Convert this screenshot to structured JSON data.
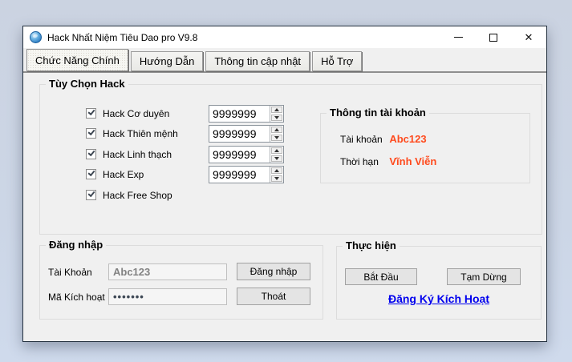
{
  "window": {
    "title": "Hack Nhất Niệm Tiêu Dao pro V9.8",
    "controls": {
      "close_glyph": "✕"
    }
  },
  "tabs": [
    {
      "label": "Chức Năng Chính",
      "active": true
    },
    {
      "label": "Hướng Dẫn",
      "active": false
    },
    {
      "label": "Thông tin cập nhật",
      "active": false
    },
    {
      "label": "Hỗ Trợ",
      "active": false
    }
  ],
  "hack_options": {
    "group_label": "Tùy Chọn Hack",
    "items": [
      {
        "label": "Hack Cơ duyên",
        "checked": true,
        "value": "9999999"
      },
      {
        "label": "Hack Thiên mệnh",
        "checked": true,
        "value": "9999999"
      },
      {
        "label": "Hack Linh thạch",
        "checked": true,
        "value": "9999999"
      },
      {
        "label": "Hack Exp",
        "checked": true,
        "value": "9999999"
      },
      {
        "label": "Hack Free Shop",
        "checked": true
      }
    ]
  },
  "account_info": {
    "group_label": "Thông tin tài khoản",
    "rows": [
      {
        "label": "Tài khoản",
        "value": "Abc123"
      },
      {
        "label": "Thời hạn",
        "value": "Vĩnh Viễn"
      }
    ]
  },
  "login": {
    "group_label": "Đăng nhập",
    "username_label": "Tài Khoản",
    "username_value": "Abc123",
    "activation_label": "Mã Kích hoạt",
    "activation_value": "•••••••",
    "login_button": "Đăng nhập",
    "exit_button": "Thoát"
  },
  "actions": {
    "group_label": "Thực hiện",
    "start_button": "Bắt Đầu",
    "pause_button": "Tạm Dừng",
    "register_link": "Đăng Ký Kích Hoạt"
  },
  "colors": {
    "accent_orange": "#ff4a1d",
    "link_blue": "#0000ee",
    "window_bg": "#f0f0f0"
  }
}
